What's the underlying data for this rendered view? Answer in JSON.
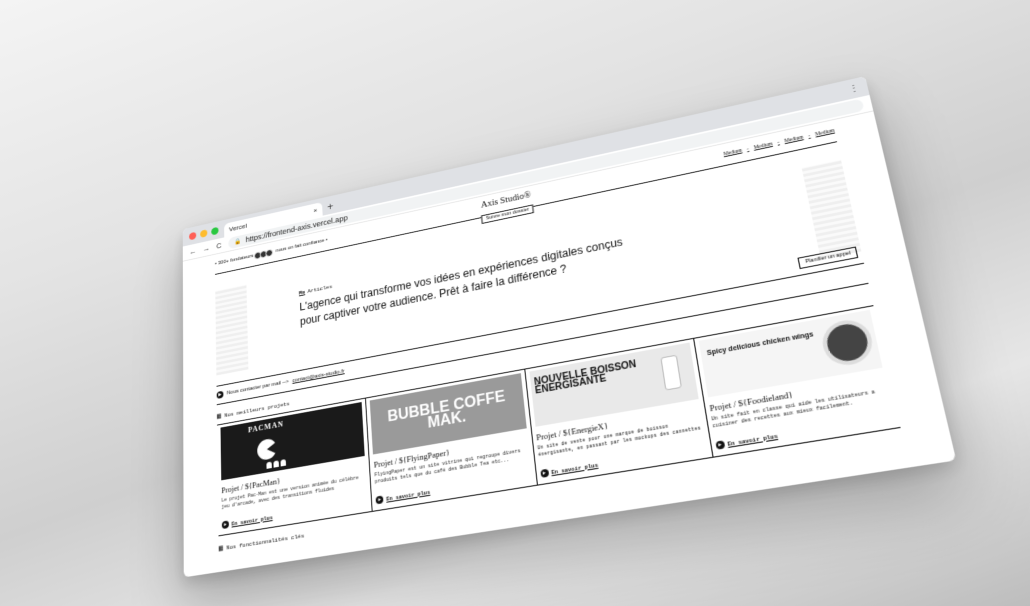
{
  "browser": {
    "tab_title": "Vercel",
    "tab_close": "×",
    "new_tab": "+",
    "menu": "⋮",
    "url": "https://frontend-axis.vercel.app",
    "nav": {
      "back": "←",
      "forward": "→",
      "reload": "C"
    }
  },
  "header": {
    "founders": "• 300+ fondateurs",
    "founders_suffix": "nous on fait confiance •",
    "brand": "Axis Studio®",
    "follow_button": "Suivre mon dossier",
    "links": [
      "Medium",
      "Medium",
      "Medium",
      "Medium"
    ],
    "separator": "-"
  },
  "hero": {
    "label_mark": "Mm",
    "label": "Articles",
    "headline": "L'agence qui transforme vos idées en expériences digitales conçus pour captiver votre audience. Prêt à faire la différence ?",
    "call_button": "Planifier un appel"
  },
  "contact": {
    "text": "Nous contacter par mail -->",
    "email": "contact@axis-studio.fr"
  },
  "projects_section": {
    "label": "Nos meilleurs projets",
    "items": [
      {
        "title": "Projet / ${PacMan}",
        "thumb_text": "PACMAN",
        "desc": "Le projet Pac-Man est une version animée du célèbre jeu d'arcade, avec des transitions fluides",
        "link": "En savoir plus"
      },
      {
        "title": "Projet / ${FlyingPaper}",
        "thumb_text": "BUBBLE COFFE MAK.",
        "desc": "FlyingPaper est un site vitrine qui regroupe divers produits tels que du café des Bubble Tea etc...",
        "link": "En savoir plus"
      },
      {
        "title": "Projet / ${EnergieX}",
        "thumb_text": "NOUVELLE BOISSON ÉNERGISANTE",
        "desc": "Un site de vente pour une marque de boisson énergisante, en passant par les mockups des cannettes",
        "link": "En savoir plus"
      },
      {
        "title": "Projet / ${Foodieland}",
        "thumb_text": "Spicy delicious chicken wings",
        "desc": "Un site fait en classe qui aide les utilisateurs a cuisiner des recettes aux mieux facilement.",
        "link": "En savoir plus"
      }
    ]
  },
  "features_section": {
    "label": "Nos fonctionnalités clés"
  }
}
